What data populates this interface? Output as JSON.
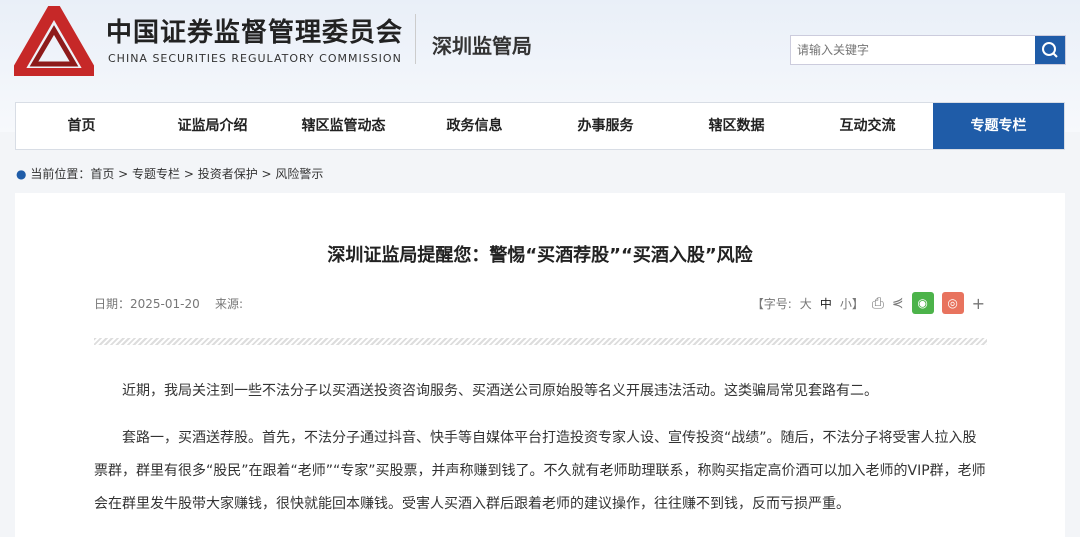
{
  "header": {
    "title_cn": "中国证券监督管理委员会",
    "title_en": "CHINA SECURITIES REGULATORY COMMISSION",
    "subtitle": "深圳监管局",
    "search_placeholder": "请输入关键字"
  },
  "nav": [
    "首页",
    "证监局介绍",
    "辖区监管动态",
    "政务信息",
    "办事服务",
    "辖区数据",
    "互动交流",
    "专题专栏"
  ],
  "breadcrumb": {
    "label": "当前位置：",
    "items": [
      "首页",
      " > 专题专栏",
      " > 投资者保护",
      " > 风险警示"
    ]
  },
  "article": {
    "title": "深圳证监局提醒您：警惕“买酒荐股”“买酒入股”风险",
    "date": "日期：2025-01-20",
    "source": "来源:",
    "font_label": "【字号:",
    "font_sizes": [
      "大",
      "中",
      "小】"
    ],
    "paragraphs": [
      "近期，我局关注到一些不法分子以买酒送投资咨询服务、买酒送公司原始股等名义开展违法活动。这类骗局常见套路有二。",
      "套路一，买酒送荐股。首先，不法分子通过抖音、快手等自媒体平台打造投资专家人设、宣传投资“战绩”。随后，不法分子将受害人拉入股票群，群里有很多“股民”在跟着“老师”“专家”买股票，并声称赚到钱了。不久就有老师助理联系，称购买指定高价酒可以加入老师的VIP群，老师会在群里发牛股带大家赚钱，很快就能回本赚钱。受害人买酒入群后跟着老师的建议操作，往往赚不到钱，反而亏损严重。"
    ]
  },
  "colors": {
    "brand": "#1f5ca8",
    "wechat": "#4cb34a",
    "weibo": "#e8735e"
  }
}
